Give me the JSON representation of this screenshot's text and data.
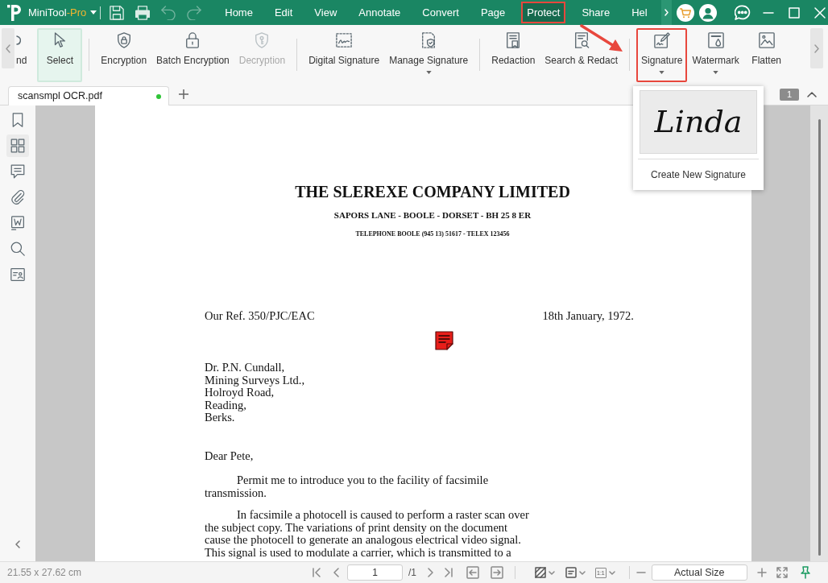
{
  "title_bar": {
    "app_name": "MiniTool",
    "edition": "-Pro",
    "quick_actions": [
      {
        "disabled": false
      },
      {
        "disabled": false
      },
      {
        "disabled": true
      },
      {
        "disabled": true
      }
    ],
    "menus": [
      {
        "label": "Home",
        "selected": false,
        "outlined": false
      },
      {
        "label": "Edit",
        "selected": false,
        "outlined": false
      },
      {
        "label": "View",
        "selected": false,
        "outlined": false
      },
      {
        "label": "Annotate",
        "selected": false,
        "outlined": false
      },
      {
        "label": "Convert",
        "selected": false,
        "outlined": false
      },
      {
        "label": "Page",
        "selected": false,
        "outlined": false
      },
      {
        "label": "Protect",
        "selected": true,
        "outlined": true
      },
      {
        "label": "Share",
        "selected": false,
        "outlined": false
      },
      {
        "label": "Hel",
        "selected": false,
        "outlined": false
      }
    ]
  },
  "callout": {
    "arrow": true
  },
  "toolbar": {
    "cut_tool": {
      "label": "nd"
    },
    "groups": [
      [
        {
          "label": "Select",
          "selected": true,
          "disabled": false,
          "dropdown": false,
          "outlined": false
        }
      ],
      [
        {
          "label": "Encryption",
          "selected": false,
          "disabled": false,
          "dropdown": false,
          "outlined": false
        },
        {
          "label": "Batch Encryption",
          "selected": false,
          "disabled": false,
          "dropdown": false,
          "outlined": false
        },
        {
          "label": "Decryption",
          "selected": false,
          "disabled": true,
          "dropdown": false,
          "outlined": false
        }
      ],
      [
        {
          "label": "Digital Signature",
          "selected": false,
          "disabled": false,
          "dropdown": false,
          "outlined": false
        },
        {
          "label": "Manage Signature",
          "selected": false,
          "disabled": false,
          "dropdown": true,
          "outlined": false
        }
      ],
      [
        {
          "label": "Redaction",
          "selected": false,
          "disabled": false,
          "dropdown": false,
          "outlined": false
        },
        {
          "label": "Search & Redact",
          "selected": false,
          "disabled": false,
          "dropdown": false,
          "outlined": false
        }
      ],
      [
        {
          "label": "Signature",
          "selected": false,
          "disabled": false,
          "dropdown": true,
          "outlined": true
        },
        {
          "label": "Watermark",
          "selected": false,
          "disabled": false,
          "dropdown": true,
          "outlined": false
        },
        {
          "label": "Flatten",
          "selected": false,
          "disabled": false,
          "dropdown": false,
          "outlined": false
        }
      ]
    ]
  },
  "document_tabs": [
    {
      "label": "scansmpl OCR.pdf",
      "selected": true,
      "marked": true
    }
  ],
  "page_badge": "1",
  "signature_menu": {
    "signatures": [
      "Linda"
    ],
    "create_label": "Create New Signature"
  },
  "sidebar": {
    "items": [
      {
        "selected": false
      },
      {
        "selected": true
      },
      {
        "selected": false
      },
      {
        "selected": false
      },
      {
        "selected": false
      },
      {
        "selected": false
      },
      {
        "selected": false
      }
    ]
  },
  "document": {
    "heading": "THE SLEREXE COMPANY LIMITED",
    "address": "SAPORS LANE - BOOLE - DORSET - BH 25 8 ER",
    "telephone": "TELEPHONE BOOLE (945 13) 51617 - TELEX 123456",
    "reference": "Our Ref. 350/PJC/EAC",
    "date": "18th January, 1972.",
    "recipient": [
      "Dr. P.N. Cundall,",
      "Mining Surveys Ltd.,",
      "Holroyd Road,",
      "Reading,",
      "Berks."
    ],
    "salutation": "Dear Pete,",
    "paragraphs": [
      [
        "Permit me to introduce you to the facility of facsimile",
        "transmission."
      ],
      [
        "In facsimile a photocell is caused to perform a raster scan over",
        "the subject copy. The variations of print density on the document",
        "cause the photocell to generate an analogous electrical video signal.",
        "This signal is used to modulate a carrier, which is transmitted to a"
      ]
    ]
  },
  "status_bar": {
    "page_size": "21.55 x 27.62 cm",
    "page_input": "1",
    "page_total": "/1",
    "ratio_label": "1:1",
    "zoom": "Actual Size"
  }
}
